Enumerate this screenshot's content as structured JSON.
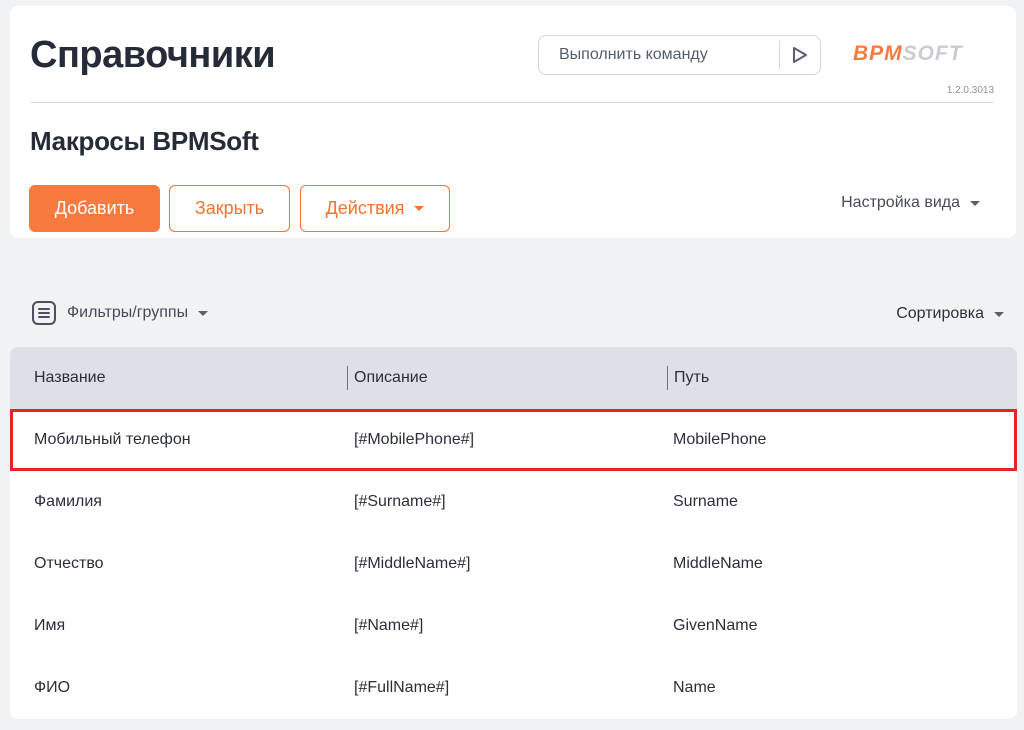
{
  "header": {
    "title": "Справочники",
    "command_placeholder": "Выполнить команду",
    "logo_text": "BPMSOFT",
    "version": "1.2.0.3013"
  },
  "section": {
    "title": "Макросы BPMSoft"
  },
  "toolbar": {
    "add_label": "Добавить",
    "close_label": "Закрыть",
    "actions_label": "Действия",
    "view_settings_label": "Настройка вида"
  },
  "list_controls": {
    "filters_label": "Фильтры/группы",
    "sorting_label": "Сортировка"
  },
  "grid": {
    "columns": [
      "Название",
      "Описание",
      "Путь"
    ],
    "rows": [
      {
        "name": "Мобильный телефон",
        "description": "[#MobilePhone#]",
        "path": "MobilePhone"
      },
      {
        "name": "Фамилия",
        "description": "[#Surname#]",
        "path": "Surname"
      },
      {
        "name": "Отчество",
        "description": "[#MiddleName#]",
        "path": "MiddleName"
      },
      {
        "name": "Имя",
        "description": "[#Name#]",
        "path": "GivenName"
      },
      {
        "name": "ФИО",
        "description": "[#FullName#]",
        "path": "Name"
      }
    ],
    "highlighted_row": 0
  },
  "colors": {
    "accent": "#f77b3e",
    "highlight_border": "#e52424"
  },
  "icons": {
    "run": "play-icon",
    "filters": "filter-list-icon",
    "dropdown": "caret-down-icon"
  }
}
